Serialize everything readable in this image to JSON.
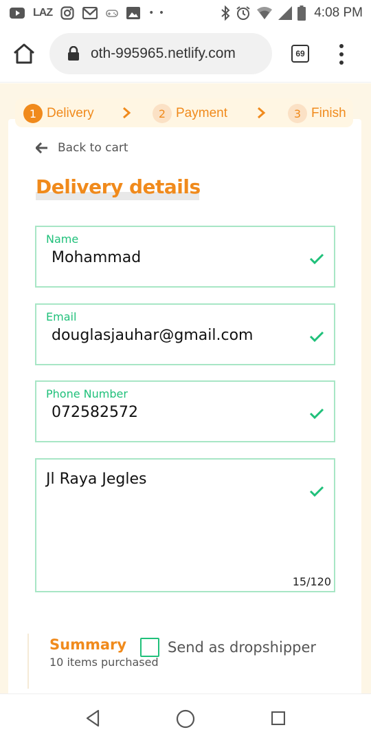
{
  "status_bar": {
    "time": "4:08 PM",
    "app_label": "LAZ"
  },
  "browser": {
    "url": "oth-995965.netlify.com",
    "tab_count": "69"
  },
  "stepper": {
    "steps": [
      {
        "number": "1",
        "label": "Delivery",
        "active": true
      },
      {
        "number": "2",
        "label": "Payment",
        "active": false
      },
      {
        "number": "3",
        "label": "Finish",
        "active": false
      }
    ]
  },
  "form": {
    "back_label": "Back to cart",
    "title": "Delivery details",
    "name": {
      "label": "Name",
      "value": "Mohammad"
    },
    "email": {
      "label": "Email",
      "value": "douglasjauhar@gmail.com"
    },
    "phone": {
      "label": "Phone Number",
      "value": "072582572"
    },
    "address": {
      "value": "Jl Raya Jegles",
      "counter": "15/120"
    },
    "dropshipper_label": "Send as dropshipper",
    "dropshipper_checked": false
  },
  "summary": {
    "title": "Summary",
    "subtitle": "10 items purchased"
  },
  "colors": {
    "accent": "#f08a1c",
    "success": "#1fc07a",
    "field_border": "#a7e6c5",
    "page_bg": "#fdf6e6"
  }
}
